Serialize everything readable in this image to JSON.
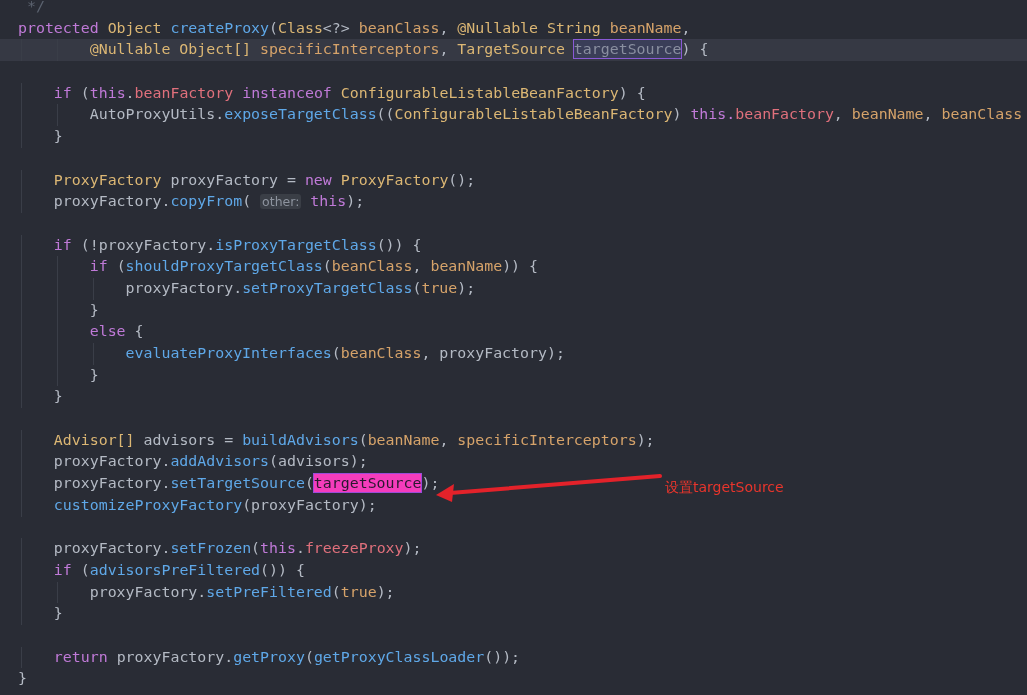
{
  "editor": {
    "lines": [
      {
        "current": false,
        "tokens": [
          {
            "kind": "comment",
            "text": " */"
          }
        ]
      },
      {
        "current": false,
        "tokens": [
          {
            "kind": "keyword",
            "text": "protected "
          },
          {
            "kind": "type",
            "text": "Object "
          },
          {
            "kind": "method",
            "text": "createProxy"
          },
          {
            "kind": "plain",
            "text": "("
          },
          {
            "kind": "type",
            "text": "Class"
          },
          {
            "kind": "plain",
            "text": "<?> "
          },
          {
            "kind": "param",
            "text": "beanClass"
          },
          {
            "kind": "plain",
            "text": ", "
          },
          {
            "kind": "type",
            "text": "@Nullable String "
          },
          {
            "kind": "param",
            "text": "beanName"
          },
          {
            "kind": "plain",
            "text": ","
          }
        ]
      },
      {
        "current": true,
        "tokens": [
          {
            "kind": "type",
            "text": "        @Nullable Object[] "
          },
          {
            "kind": "param",
            "text": "specificInterceptors"
          },
          {
            "kind": "plain",
            "text": ", "
          },
          {
            "kind": "type",
            "text": "TargetSource "
          },
          {
            "kind": "outlined",
            "text": "targetSource"
          },
          {
            "kind": "plain",
            "text": ") {"
          }
        ]
      },
      {
        "current": false
      },
      {
        "current": false,
        "tokens": [
          {
            "kind": "keyword",
            "text": "    if "
          },
          {
            "kind": "plain",
            "text": "("
          },
          {
            "kind": "keyword",
            "text": "this"
          },
          {
            "kind": "plain",
            "text": "."
          },
          {
            "kind": "field",
            "text": "beanFactory"
          },
          {
            "kind": "keyword",
            "text": " instanceof "
          },
          {
            "kind": "type",
            "text": "ConfigurableListableBeanFactory"
          },
          {
            "kind": "plain",
            "text": ") {"
          }
        ]
      },
      {
        "current": false,
        "tokens": [
          {
            "kind": "plain",
            "text": "        AutoProxyUtils."
          },
          {
            "kind": "method",
            "text": "exposeTargetClass"
          },
          {
            "kind": "plain",
            "text": "(("
          },
          {
            "kind": "type",
            "text": "ConfigurableListableBeanFactory"
          },
          {
            "kind": "plain",
            "text": ") "
          },
          {
            "kind": "keyword",
            "text": "this."
          },
          {
            "kind": "field",
            "text": "beanFactory"
          },
          {
            "kind": "plain",
            "text": ", "
          },
          {
            "kind": "param",
            "text": "beanName"
          },
          {
            "kind": "plain",
            "text": ", "
          },
          {
            "kind": "param",
            "text": "beanClass"
          }
        ]
      },
      {
        "current": false,
        "tokens": [
          {
            "kind": "plain",
            "text": "    }"
          }
        ]
      },
      {
        "current": false
      },
      {
        "current": false,
        "tokens": [
          {
            "kind": "type",
            "text": "    ProxyFactory "
          },
          {
            "kind": "plain",
            "text": "proxyFactory = "
          },
          {
            "kind": "keyword",
            "text": "new "
          },
          {
            "kind": "type",
            "text": "ProxyFactory"
          },
          {
            "kind": "plain",
            "text": "();"
          }
        ]
      },
      {
        "current": false,
        "tokens": [
          {
            "kind": "plain",
            "text": "    proxyFactory."
          },
          {
            "kind": "method",
            "text": "copyFrom"
          },
          {
            "kind": "plain",
            "text": "( "
          },
          {
            "kind": "hint",
            "text": "other:"
          },
          {
            "kind": "keyword",
            "text": " this"
          },
          {
            "kind": "plain",
            "text": ");"
          }
        ]
      },
      {
        "current": false
      },
      {
        "current": false,
        "tokens": [
          {
            "kind": "keyword",
            "text": "    if "
          },
          {
            "kind": "plain",
            "text": "(!proxyFactory."
          },
          {
            "kind": "method",
            "text": "isProxyTargetClass"
          },
          {
            "kind": "plain",
            "text": "()) {"
          }
        ]
      },
      {
        "current": false,
        "tokens": [
          {
            "kind": "keyword",
            "text": "        if "
          },
          {
            "kind": "plain",
            "text": "("
          },
          {
            "kind": "method",
            "text": "shouldProxyTargetClass"
          },
          {
            "kind": "plain",
            "text": "("
          },
          {
            "kind": "param",
            "text": "beanClass"
          },
          {
            "kind": "plain",
            "text": ", "
          },
          {
            "kind": "param",
            "text": "beanName"
          },
          {
            "kind": "plain",
            "text": ")) {"
          }
        ]
      },
      {
        "current": false,
        "tokens": [
          {
            "kind": "plain",
            "text": "            proxyFactory."
          },
          {
            "kind": "method",
            "text": "setProxyTargetClass"
          },
          {
            "kind": "plain",
            "text": "("
          },
          {
            "kind": "literal",
            "text": "true"
          },
          {
            "kind": "plain",
            "text": ");"
          }
        ]
      },
      {
        "current": false,
        "tokens": [
          {
            "kind": "plain",
            "text": "        }"
          }
        ]
      },
      {
        "current": false,
        "tokens": [
          {
            "kind": "keyword",
            "text": "        else "
          },
          {
            "kind": "plain",
            "text": "{"
          }
        ]
      },
      {
        "current": false,
        "tokens": [
          {
            "kind": "method",
            "text": "            evaluateProxyInterfaces"
          },
          {
            "kind": "plain",
            "text": "("
          },
          {
            "kind": "param",
            "text": "beanClass"
          },
          {
            "kind": "plain",
            "text": ", proxyFactory);"
          }
        ]
      },
      {
        "current": false,
        "tokens": [
          {
            "kind": "plain",
            "text": "        }"
          }
        ]
      },
      {
        "current": false,
        "tokens": [
          {
            "kind": "plain",
            "text": "    }"
          }
        ]
      },
      {
        "current": false
      },
      {
        "current": false,
        "tokens": [
          {
            "kind": "type",
            "text": "    Advisor[] "
          },
          {
            "kind": "plain",
            "text": "advisors = "
          },
          {
            "kind": "method",
            "text": "buildAdvisors"
          },
          {
            "kind": "plain",
            "text": "("
          },
          {
            "kind": "param",
            "text": "beanName"
          },
          {
            "kind": "plain",
            "text": ", "
          },
          {
            "kind": "param",
            "text": "specificInterceptors"
          },
          {
            "kind": "plain",
            "text": ");"
          }
        ]
      },
      {
        "current": false,
        "tokens": [
          {
            "kind": "plain",
            "text": "    proxyFactory."
          },
          {
            "kind": "method",
            "text": "addAdvisors"
          },
          {
            "kind": "plain",
            "text": "(advisors);"
          }
        ]
      },
      {
        "current": false,
        "tokens": [
          {
            "kind": "plain",
            "text": "    proxyFactory."
          },
          {
            "kind": "method",
            "text": "setTargetSource"
          },
          {
            "kind": "plain",
            "text": "("
          },
          {
            "kind": "marked",
            "text": "targetSource"
          },
          {
            "kind": "plain",
            "text": ");"
          }
        ]
      },
      {
        "current": false,
        "tokens": [
          {
            "kind": "method",
            "text": "    customizeProxyFactory"
          },
          {
            "kind": "plain",
            "text": "(proxyFactory);"
          }
        ]
      },
      {
        "current": false
      },
      {
        "current": false,
        "tokens": [
          {
            "kind": "plain",
            "text": "    proxyFactory."
          },
          {
            "kind": "method",
            "text": "setFrozen"
          },
          {
            "kind": "plain",
            "text": "("
          },
          {
            "kind": "keyword",
            "text": "this"
          },
          {
            "kind": "plain",
            "text": "."
          },
          {
            "kind": "field",
            "text": "freezeProxy"
          },
          {
            "kind": "plain",
            "text": ");"
          }
        ]
      },
      {
        "current": false,
        "tokens": [
          {
            "kind": "keyword",
            "text": "    if "
          },
          {
            "kind": "plain",
            "text": "("
          },
          {
            "kind": "method",
            "text": "advisorsPreFiltered"
          },
          {
            "kind": "plain",
            "text": "()) {"
          }
        ]
      },
      {
        "current": false,
        "tokens": [
          {
            "kind": "plain",
            "text": "        proxyFactory."
          },
          {
            "kind": "method",
            "text": "setPreFiltered"
          },
          {
            "kind": "plain",
            "text": "("
          },
          {
            "kind": "literal",
            "text": "true"
          },
          {
            "kind": "plain",
            "text": ");"
          }
        ]
      },
      {
        "current": false,
        "tokens": [
          {
            "kind": "plain",
            "text": "    }"
          }
        ]
      },
      {
        "current": false
      },
      {
        "current": false,
        "tokens": [
          {
            "kind": "keyword",
            "text": "    return "
          },
          {
            "kind": "plain",
            "text": "proxyFactory."
          },
          {
            "kind": "method",
            "text": "getProxy"
          },
          {
            "kind": "plain",
            "text": "("
          },
          {
            "kind": "method",
            "text": "getProxyClassLoader"
          },
          {
            "kind": "plain",
            "text": "());"
          }
        ]
      },
      {
        "current": false,
        "tokens": [
          {
            "kind": "plain",
            "text": "}"
          }
        ]
      }
    ]
  },
  "annotation": {
    "text": "设置targetSource"
  }
}
